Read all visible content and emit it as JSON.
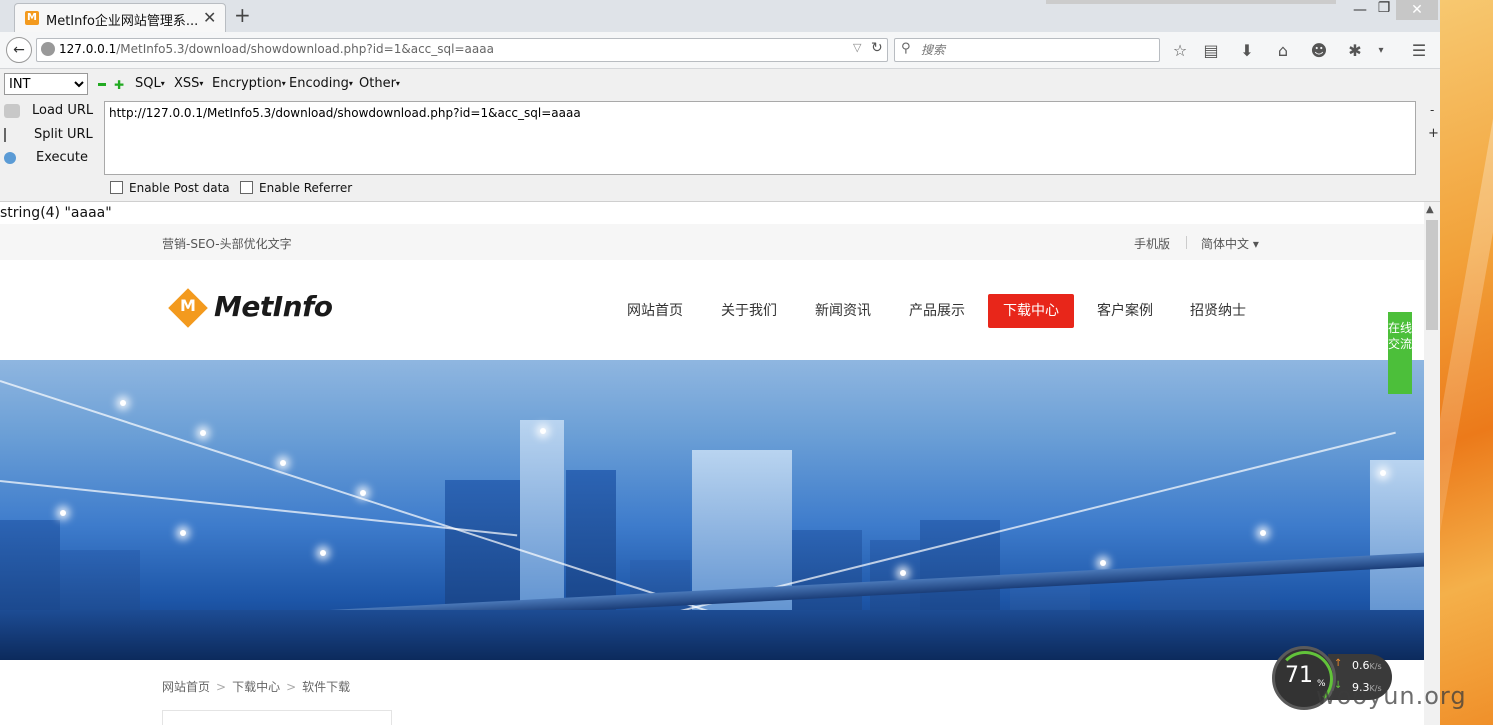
{
  "browser": {
    "tab_title": "MetInfo企业网站管理系...",
    "favicon_letter": "M",
    "new_tab": "+",
    "close_tab": "✕",
    "window_controls": {
      "minimize": "—",
      "maximize": "❐",
      "close": "✕"
    },
    "url_host": "127.0.0.1",
    "url_path": "/MetInfo5.3/download/showdownload.php?id=1&acc_sql=aaaa",
    "search_placeholder": "搜索",
    "toolbar_icons": [
      "star-icon",
      "clipboard-icon",
      "download-icon",
      "home-icon",
      "smiley-icon",
      "bug-icon",
      "dropdown-icon",
      "menu-icon"
    ]
  },
  "hackbar": {
    "type_select": "INT",
    "menus": [
      "SQL",
      "XSS",
      "Encryption",
      "Encoding",
      "Other"
    ],
    "actions": [
      "Load URL",
      "Split URL",
      "Execute"
    ],
    "url_value": "http://127.0.0.1/MetInfo5.3/download/showdownload.php?id=1&acc_sql=aaaa",
    "enable_post": "Enable Post data",
    "enable_referrer": "Enable Referrer",
    "side_minus": "-",
    "side_plus": "+"
  },
  "page": {
    "debug_output": "string(4) \"aaaa\"",
    "topbar_text": "营销-SEO-头部优化文字",
    "mobile_link": "手机版",
    "lang_link": "简体中文 ▾",
    "logo_text": "MetInfo",
    "logo_mark": "M",
    "nav": [
      "网站首页",
      "关于我们",
      "新闻资讯",
      "产品展示",
      "下载中心",
      "客户案例",
      "招贤纳士"
    ],
    "nav_active_index": 4,
    "breadcrumb": [
      "网站首页",
      "下载中心",
      "软件下载"
    ],
    "breadcrumb_sep": ">",
    "online_chat": "在线交流"
  },
  "widget": {
    "cpu_percent": "71",
    "percent_sign": "%",
    "upload": "0.6",
    "download": "9.3",
    "unit": "K/s",
    "watermark": "wooyun.org"
  },
  "colors": {
    "active_nav": "#e8261a",
    "chat_green": "#4cbf3a",
    "logo_orange": "#f39a1e"
  }
}
